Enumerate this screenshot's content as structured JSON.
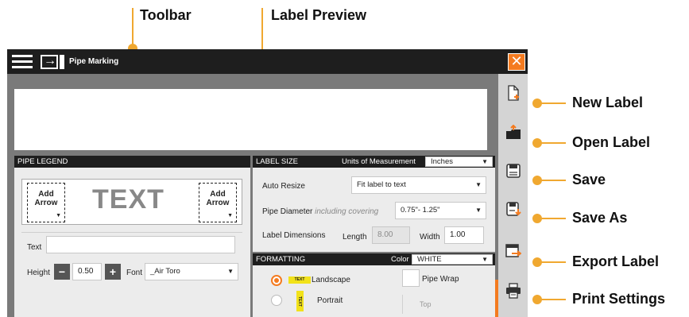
{
  "callouts": {
    "toolbar": "Toolbar",
    "label_preview": "Label Preview",
    "new_label": "New Label",
    "open_label": "Open Label",
    "save": "Save",
    "save_as": "Save As",
    "export_label": "Export Label",
    "print_settings": "Print Settings"
  },
  "titlebar": {
    "title": "Pipe Marking",
    "close_symbol": "✕"
  },
  "pipe_legend": {
    "header": "PIPE LEGEND",
    "left_arrow_label": "Add\nArrow",
    "right_arrow_label": "Add\nArrow",
    "preview_text": "TEXT",
    "text_label": "Text",
    "text_value": "",
    "height_label": "Height",
    "height_value": "0.50",
    "font_label": "Font",
    "font_value": "_Air Toro"
  },
  "label_size": {
    "header": "LABEL SIZE",
    "units_label": "Units of Measurement",
    "units_value": "Inches",
    "auto_resize_label": "Auto Resize",
    "auto_resize_value": "Fit label to text",
    "pipe_diameter_label": "Pipe Diameter",
    "pipe_diameter_note": "including covering",
    "pipe_diameter_value": "0.75\"- 1.25\"",
    "dimensions_label": "Label Dimensions",
    "length_label": "Length",
    "length_value": "8.00",
    "width_label": "Width",
    "width_value": "1.00"
  },
  "formatting": {
    "header": "FORMATTING",
    "color_label": "Color",
    "color_value": "WHITE",
    "landscape_label": "Landscape",
    "landscape_chip": "TEXT",
    "portrait_label": "Portrait",
    "portrait_chip": "TEXT",
    "pipe_wrap_label": "Pipe Wrap",
    "top_label": "Top"
  },
  "colors": {
    "accent": "#f47b20",
    "callout_line": "#f0a830",
    "titlebar": "#1e1e1e",
    "panel_bg": "#ececec",
    "chip_yellow": "#f2e21a"
  }
}
